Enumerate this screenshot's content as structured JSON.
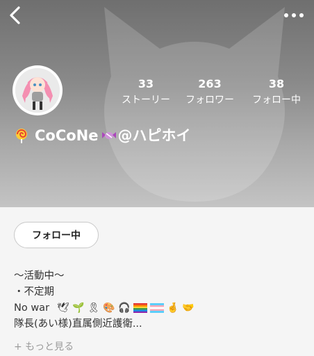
{
  "header": {
    "back_icon": "chevron-left-icon",
    "more_icon": "more-horizontal-icon"
  },
  "profile": {
    "display_name": "CoCoNe",
    "handle": "@ハピホイ",
    "name_emoji_before": "lollipop",
    "name_emoji_after": "candy",
    "stats": [
      {
        "value": "33",
        "label": "ストーリー"
      },
      {
        "value": "263",
        "label": "フォロワー"
      },
      {
        "value": "38",
        "label": "フォロー中"
      }
    ]
  },
  "actions": {
    "follow_button_label": "フォロー中"
  },
  "bio": {
    "line1": "〜活動中〜",
    "line2": "・不定期",
    "line3_text": "No war",
    "line3_emojis": [
      "🕊",
      "🌱",
      "🎗",
      "🎨",
      "🎧",
      "🏳",
      "🏳",
      "🤞",
      "🤝"
    ],
    "line4": "隊長(あい様)直属側近護衛..."
  },
  "more_link_label": "+ もっと見る",
  "colors": {
    "header_top": "#6f6f6f",
    "header_bottom": "#c4c4c4",
    "content_bg": "#f5f5f5",
    "muted_text": "#9a9a9a"
  }
}
